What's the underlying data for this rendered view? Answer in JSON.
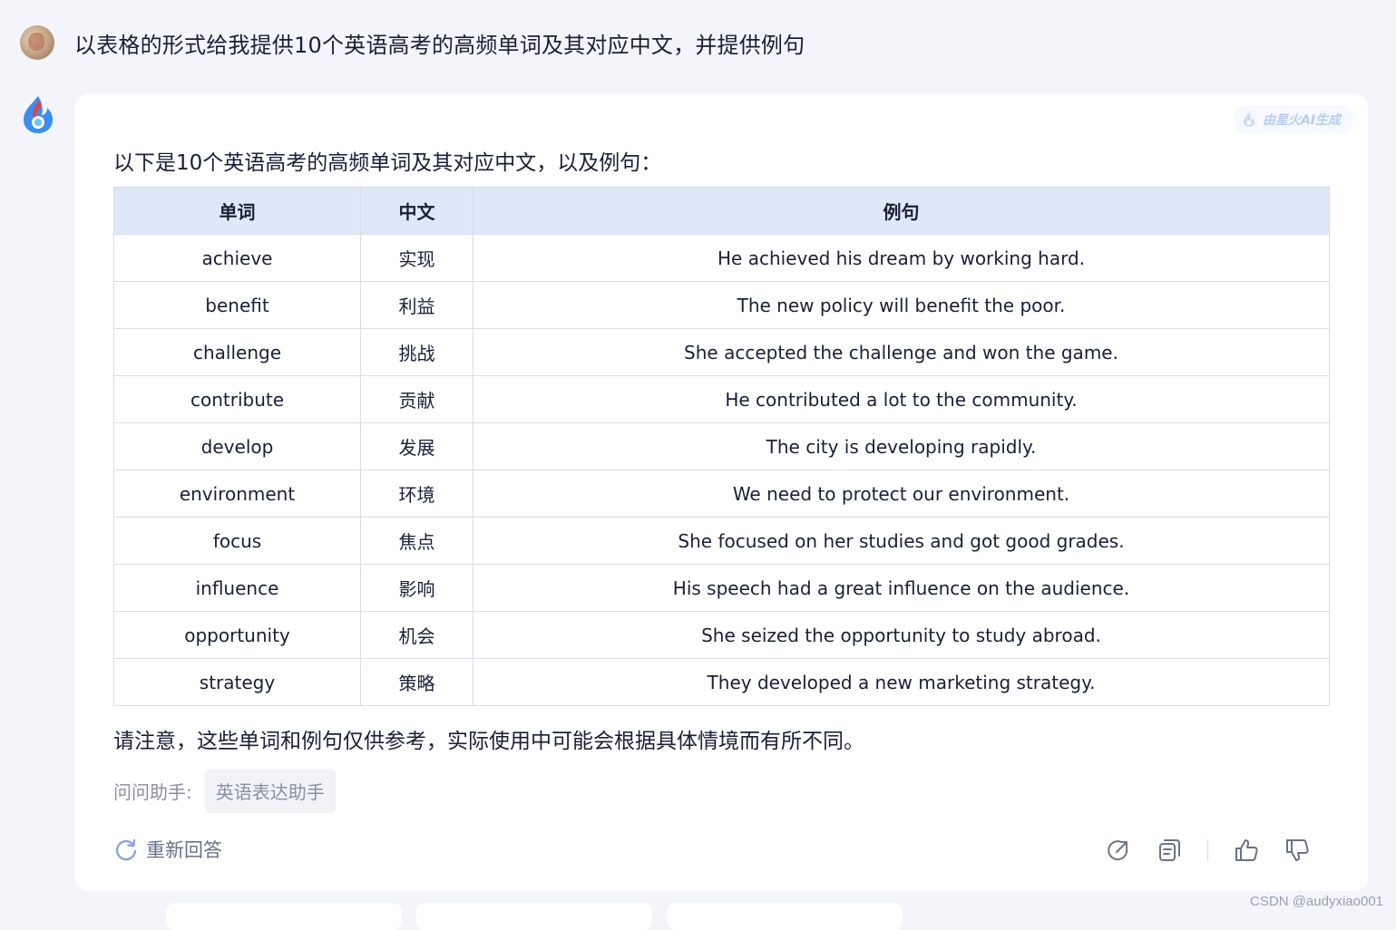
{
  "user": {
    "question": "以表格的形式给我提供10个英语高考的高频单词及其对应中文，并提供例句"
  },
  "answer": {
    "ai_badge": "由星火AI生成",
    "intro": "以下是10个英语高考的高频单词及其对应中文，以及例句：",
    "table": {
      "headers": [
        "单词",
        "中文",
        "例句"
      ],
      "rows": [
        [
          "achieve",
          "实现",
          "He achieved his dream by working hard."
        ],
        [
          "benefit",
          "利益",
          "The new policy will benefit the poor."
        ],
        [
          "challenge",
          "挑战",
          "She accepted the challenge and won the game."
        ],
        [
          "contribute",
          "贡献",
          "He contributed a lot to the community."
        ],
        [
          "develop",
          "发展",
          "The city is developing rapidly."
        ],
        [
          "environment",
          "环境",
          "We need to protect our environment."
        ],
        [
          "focus",
          "焦点",
          "She focused on her studies and got good grades."
        ],
        [
          "influence",
          "影响",
          "His speech had a great influence on the audience."
        ],
        [
          "opportunity",
          "机会",
          "She seized the opportunity to study abroad."
        ],
        [
          "strategy",
          "策略",
          "They developed a new marketing strategy."
        ]
      ]
    },
    "note": "请注意，这些单词和例句仅供参考，实际使用中可能会根据具体情境而有所不同。",
    "ask_label": "问问助手:",
    "ask_assistant": "英语表达助手",
    "regenerate": "重新回答",
    "action_icons": [
      "share-icon",
      "copy-icon",
      "thumbs-up-icon",
      "thumbs-down-icon"
    ]
  },
  "watermark": "CSDN @audyxiao001",
  "colors": {
    "page_bg": "#f3f5fb",
    "table_header_bg": "#dde9fb",
    "text": "#1a1f36",
    "muted": "#8a90a3"
  }
}
